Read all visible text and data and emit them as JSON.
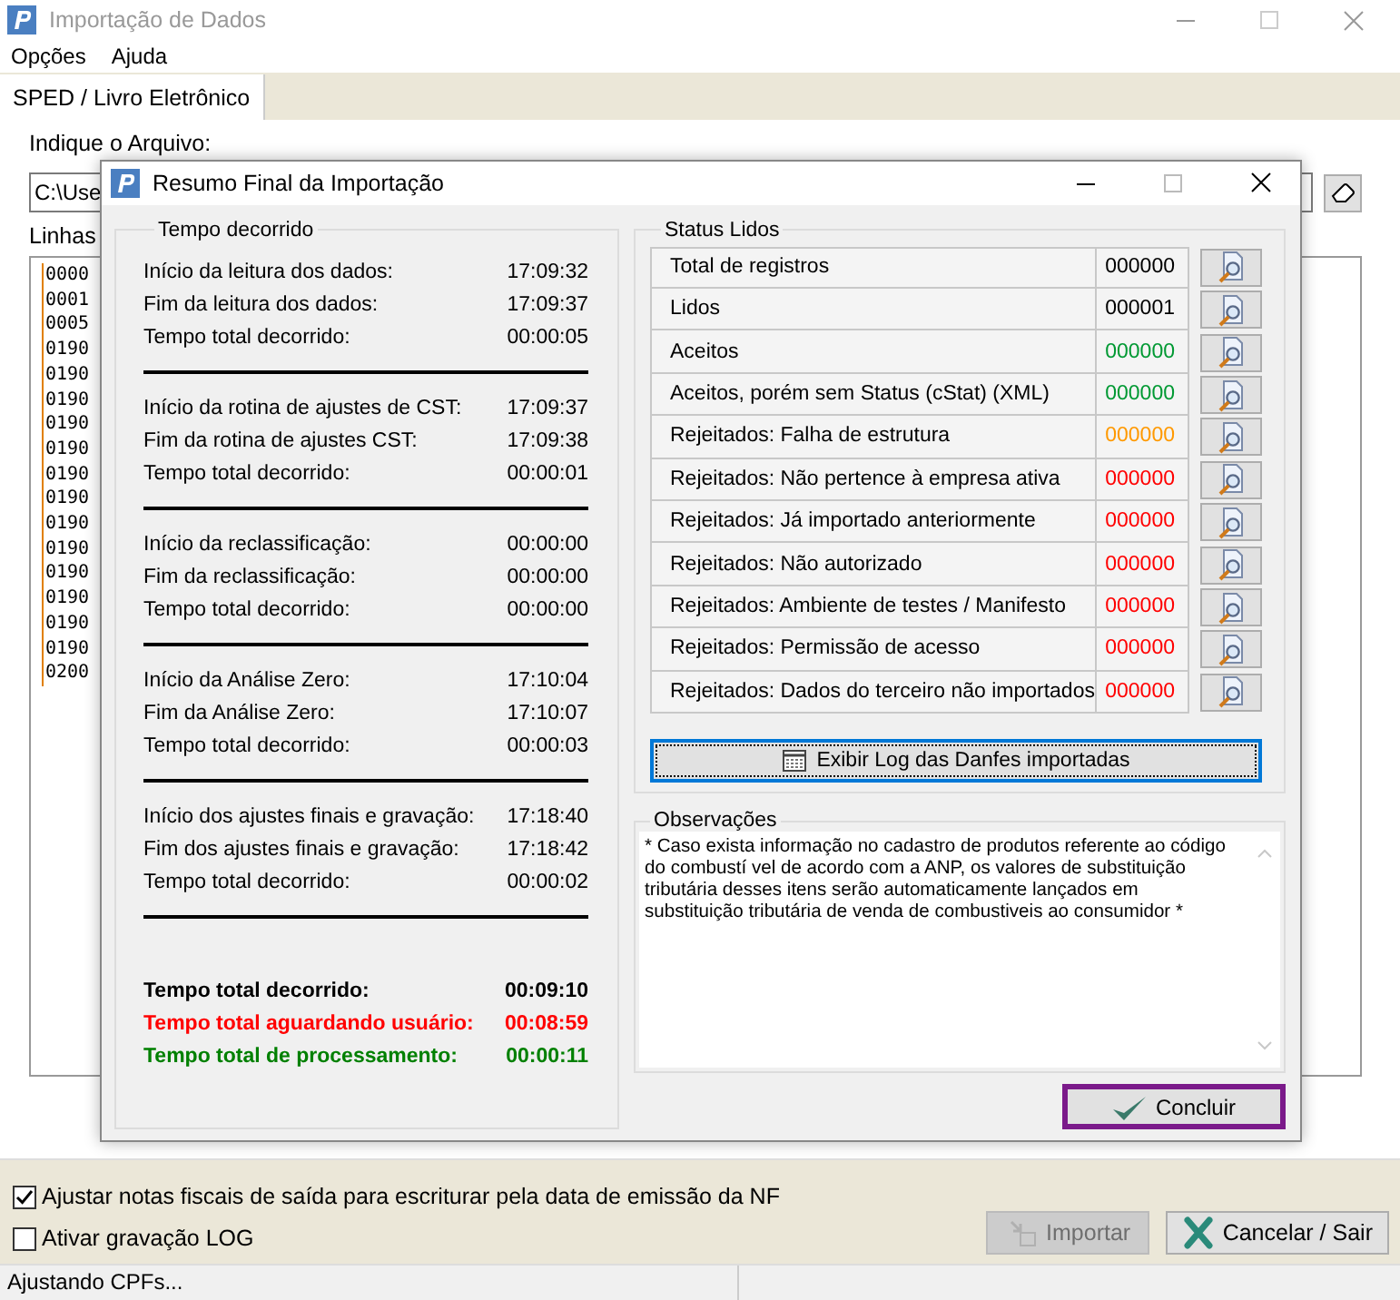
{
  "window": {
    "title": "Importação de Dados"
  },
  "menu": [
    "Opções",
    "Ajuda"
  ],
  "tabs": [
    {
      "label": "SPED / Livro Eletrônico",
      "selected": true
    }
  ],
  "file": {
    "label": "Indique o Arquivo:",
    "value": "C:\\Use"
  },
  "lines": {
    "label": "Linhas",
    "rows": [
      "0000",
      "0001",
      "0005",
      "0190",
      "0190",
      "0190",
      "0190",
      "0190",
      "0190",
      "0190",
      "0190",
      "0190",
      "0190",
      "0190",
      "0190",
      "0190",
      "0200"
    ]
  },
  "options": [
    {
      "label": "Ajustar notas fiscais de saída para escriturar pela data de emissão da NF",
      "checked": true
    },
    {
      "label": "Ativar gravação LOG",
      "checked": false
    }
  ],
  "buttons": [
    {
      "label": "Importar",
      "kind": "import",
      "disabled": true
    },
    {
      "label": "Cancelar / Sair",
      "kind": "cancel",
      "disabled": false
    }
  ],
  "status_bar": "Ajustando CPFs...",
  "dialog": {
    "title": "Resumo Final da Importação",
    "time_group": {
      "title": "Tempo decorrido",
      "sections": [
        [
          {
            "label": "Início da leitura dos dados:",
            "value": "17:09:32"
          },
          {
            "label": "Fim da leitura dos dados:",
            "value": "17:09:37"
          },
          {
            "label": "Tempo total decorrido:",
            "value": "00:00:05"
          }
        ],
        [
          {
            "label": "Início da rotina de ajustes de CST:",
            "value": "17:09:37"
          },
          {
            "label": "Fim da rotina de ajustes CST:",
            "value": "17:09:38"
          },
          {
            "label": "Tempo total decorrido:",
            "value": "00:00:01"
          }
        ],
        [
          {
            "label": "Início da reclassificação:",
            "value": "00:00:00"
          },
          {
            "label": "Fim da reclassificação:",
            "value": "00:00:00"
          },
          {
            "label": "Tempo total decorrido:",
            "value": "00:00:00"
          }
        ],
        [
          {
            "label": "Início da Análise Zero:",
            "value": "17:10:04"
          },
          {
            "label": "Fim da Análise Zero:",
            "value": "17:10:07"
          },
          {
            "label": "Tempo total decorrido:",
            "value": "00:00:03"
          }
        ],
        [
          {
            "label": "Início dos ajustes finais e gravação:",
            "value": "17:18:40"
          },
          {
            "label": "Fim dos ajustes finais e gravação:",
            "value": "17:18:42"
          },
          {
            "label": "Tempo total decorrido:",
            "value": "00:00:02"
          }
        ]
      ],
      "totals": [
        {
          "label": "Tempo total decorrido:",
          "value": "00:09:10",
          "color": "#000000"
        },
        {
          "label": "Tempo total aguardando usuário:",
          "value": "00:08:59",
          "color": "#ff0000"
        },
        {
          "label": "Tempo total de processamento:",
          "value": "00:00:11",
          "color": "#008000"
        }
      ]
    },
    "status_group": {
      "title": "Status Lidos",
      "rows": [
        {
          "label": "Total de registros",
          "value": "000000",
          "color": "#000000"
        },
        {
          "label": "Lidos",
          "value": "000001",
          "color": "#000000"
        },
        {
          "label": "Aceitos",
          "value": "000000",
          "color": "#009933"
        },
        {
          "label": "Aceitos, porém sem Status (cStat) (XML)",
          "value": "000000",
          "color": "#009933"
        },
        {
          "label": "Rejeitados: Falha de estrutura",
          "value": "000000",
          "color": "#ff9900"
        },
        {
          "label": "Rejeitados: Não pertence à empresa ativa",
          "value": "000000",
          "color": "#ff0000"
        },
        {
          "label": "Rejeitados: Já importado anteriormente",
          "value": "000000",
          "color": "#ff0000"
        },
        {
          "label": "Rejeitados: Não autorizado",
          "value": "000000",
          "color": "#ff0000"
        },
        {
          "label": "Rejeitados: Ambiente de testes / Manifesto",
          "value": "000000",
          "color": "#ff0000"
        },
        {
          "label": "Rejeitados: Permissão de acesso",
          "value": "000000",
          "color": "#ff0000"
        },
        {
          "label": "Rejeitados: Dados do terceiro não importados",
          "value": "000000",
          "color": "#ff0000"
        }
      ],
      "log_button": "Exibir Log das Danfes importadas"
    },
    "notes": {
      "title": "Observações",
      "text": "* Caso exista informação no cadastro de produtos referente ao código do combustí vel de acordo com a ANP, os valores de substituição tributária desses itens serão automaticamente lançados em substituição tributária de venda de combustiveis ao consumidor *"
    },
    "confirm_button": "Concluir"
  }
}
